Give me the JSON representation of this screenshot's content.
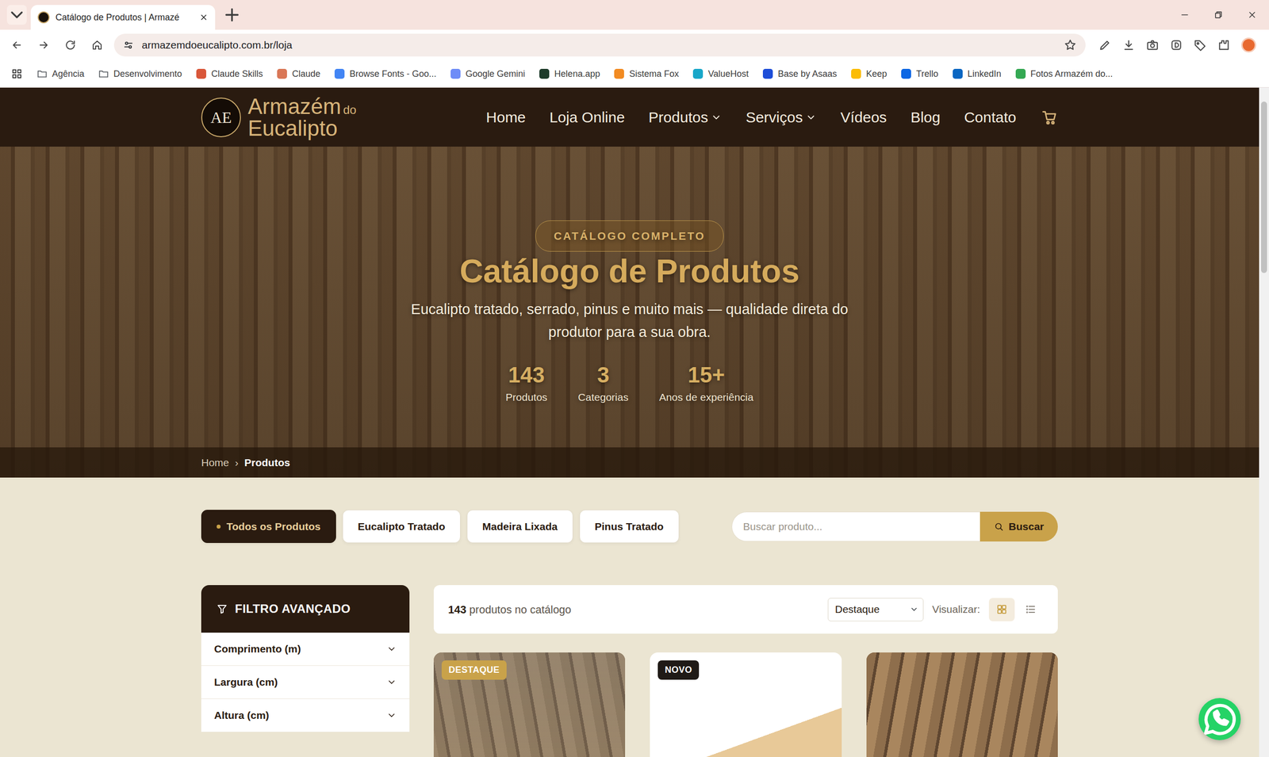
{
  "browser": {
    "tabs": [
      {
        "label": "Catálogo de Produtos | Armazé",
        "selected": true
      }
    ],
    "address": "armazemdoeucalipto.com.br/loja",
    "bookmarks": [
      {
        "label": "Agência",
        "kind": "folder",
        "color": "#5f6368"
      },
      {
        "label": "Desenvolvimento",
        "kind": "folder",
        "color": "#5f6368"
      },
      {
        "label": "Claude Skills",
        "kind": "site",
        "color": "#d9573a"
      },
      {
        "label": "Claude",
        "kind": "site",
        "color": "#d97757"
      },
      {
        "label": "Browse Fonts - Goo...",
        "kind": "site",
        "color": "#4285f4"
      },
      {
        "label": "Google Gemini",
        "kind": "site",
        "color": "#6e8cf7"
      },
      {
        "label": "Helena.app",
        "kind": "site",
        "color": "#1d3b2a"
      },
      {
        "label": "Sistema Fox",
        "kind": "site",
        "color": "#f28b22"
      },
      {
        "label": "ValueHost",
        "kind": "site",
        "color": "#19a7c9"
      },
      {
        "label": "Base by Asaas",
        "kind": "site",
        "color": "#1e4ed8"
      },
      {
        "label": "Keep",
        "kind": "site",
        "color": "#fbbc04"
      },
      {
        "label": "Trello",
        "kind": "site",
        "color": "#0c66e4"
      },
      {
        "label": "LinkedIn",
        "kind": "site",
        "color": "#0a66c2"
      },
      {
        "label": "Fotos Armazém do...",
        "kind": "site",
        "color": "#34a853"
      }
    ]
  },
  "site": {
    "logo": {
      "monogram": "AE",
      "line1": "Armazém",
      "small": "do",
      "line2": "Eucalipto"
    },
    "nav": [
      {
        "label": "Home",
        "dropdown": false
      },
      {
        "label": "Loja Online",
        "dropdown": false
      },
      {
        "label": "Produtos",
        "dropdown": true
      },
      {
        "label": "Serviços",
        "dropdown": true
      },
      {
        "label": "Vídeos",
        "dropdown": false
      },
      {
        "label": "Blog",
        "dropdown": false
      },
      {
        "label": "Contato",
        "dropdown": false
      }
    ],
    "hero": {
      "badge": "CATÁLOGO COMPLETO",
      "title": "Catálogo de Produtos",
      "subtitle": "Eucalipto tratado, serrado, pinus e muito mais — qualidade direta do produtor para a sua obra.",
      "stats": [
        {
          "value": "143",
          "label": "Produtos"
        },
        {
          "value": "3",
          "label": "Categorias"
        },
        {
          "value": "15+",
          "label": "Anos de experiência"
        }
      ]
    },
    "breadcrumb": {
      "separator": "›",
      "items": [
        {
          "label": "Home",
          "current": false
        },
        {
          "label": "Produtos",
          "current": true
        }
      ]
    },
    "categories": [
      {
        "label": "Todos os Produtos",
        "selected": true
      },
      {
        "label": "Eucalipto Tratado",
        "selected": false
      },
      {
        "label": "Madeira Lixada",
        "selected": false
      },
      {
        "label": "Pinus Tratado",
        "selected": false
      }
    ],
    "search": {
      "placeholder": "Buscar produto...",
      "button": "Buscar"
    },
    "filter": {
      "title": "FILTRO AVANÇADO",
      "groups": [
        {
          "label": "Comprimento (m)",
          "expanded": false
        },
        {
          "label": "Largura (cm)",
          "expanded": false
        },
        {
          "label": "Altura (cm)",
          "expanded": false
        }
      ]
    },
    "toolbar": {
      "count": "143",
      "count_label": "produtos no catálogo",
      "sort": "Destaque",
      "view_label": "Visualizar:",
      "views": [
        {
          "kind": "grid",
          "selected": true
        },
        {
          "kind": "list",
          "selected": false
        }
      ]
    },
    "products": [
      {
        "badge": {
          "label": "DESTAQUE",
          "color": "#c9a24a"
        }
      },
      {
        "badge": {
          "label": "NOVO",
          "color": "#1f1a16"
        }
      },
      {
        "badge": null
      }
    ]
  }
}
